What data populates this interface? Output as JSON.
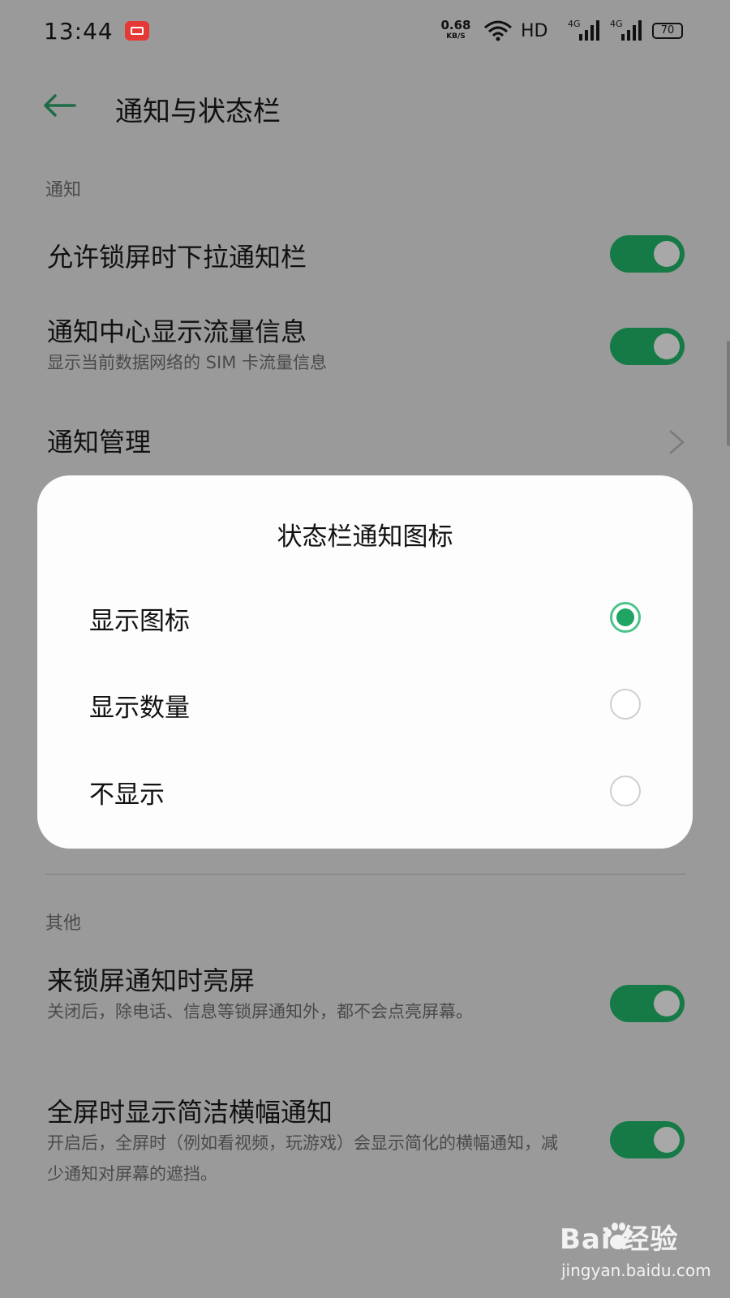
{
  "status_bar": {
    "time": "13:44",
    "net_speed_value": "0.68",
    "net_speed_unit": "KB/S",
    "hd_label": "HD",
    "signal1_label": "4G",
    "signal2_label": "4G",
    "battery": "70",
    "rec_color": "#e53935"
  },
  "header": {
    "title": "通知与状态栏",
    "back_icon": "arrow-left-icon",
    "accent": "#1e8a55"
  },
  "sections": {
    "notification_label": "通知",
    "other_label": "其他"
  },
  "settings": [
    {
      "title": "允许锁屏时下拉通知栏",
      "subtitle": "",
      "toggle": true
    },
    {
      "title": "通知中心显示流量信息",
      "subtitle": "显示当前数据网络的 SIM 卡流量信息",
      "toggle": true
    },
    {
      "title": "通知管理",
      "subtitle": "",
      "toggle": null
    },
    {
      "title": "来锁屏通知时亮屏",
      "subtitle": "关闭后，除电话、信息等锁屏通知外，都不会点亮屏幕。",
      "toggle": true
    },
    {
      "title": "全屏时显示简洁横幅通知",
      "subtitle": "开启后，全屏时（例如看视频，玩游戏）会显示简化的横幅通知，减少通知对屏幕的遮挡。",
      "toggle": true
    }
  ],
  "dialog": {
    "title": "状态栏通知图标",
    "options": [
      {
        "label": "显示图标",
        "selected": true
      },
      {
        "label": "显示数量",
        "selected": false
      },
      {
        "label": "不显示",
        "selected": false
      }
    ]
  },
  "watermark": {
    "brand": "Bai  经验",
    "url": "jingyan.baidu.com"
  },
  "colors": {
    "toggle_on": "#157a45",
    "radio_selected": "#1fa463",
    "overlay_bg": "#9a9a9a"
  }
}
